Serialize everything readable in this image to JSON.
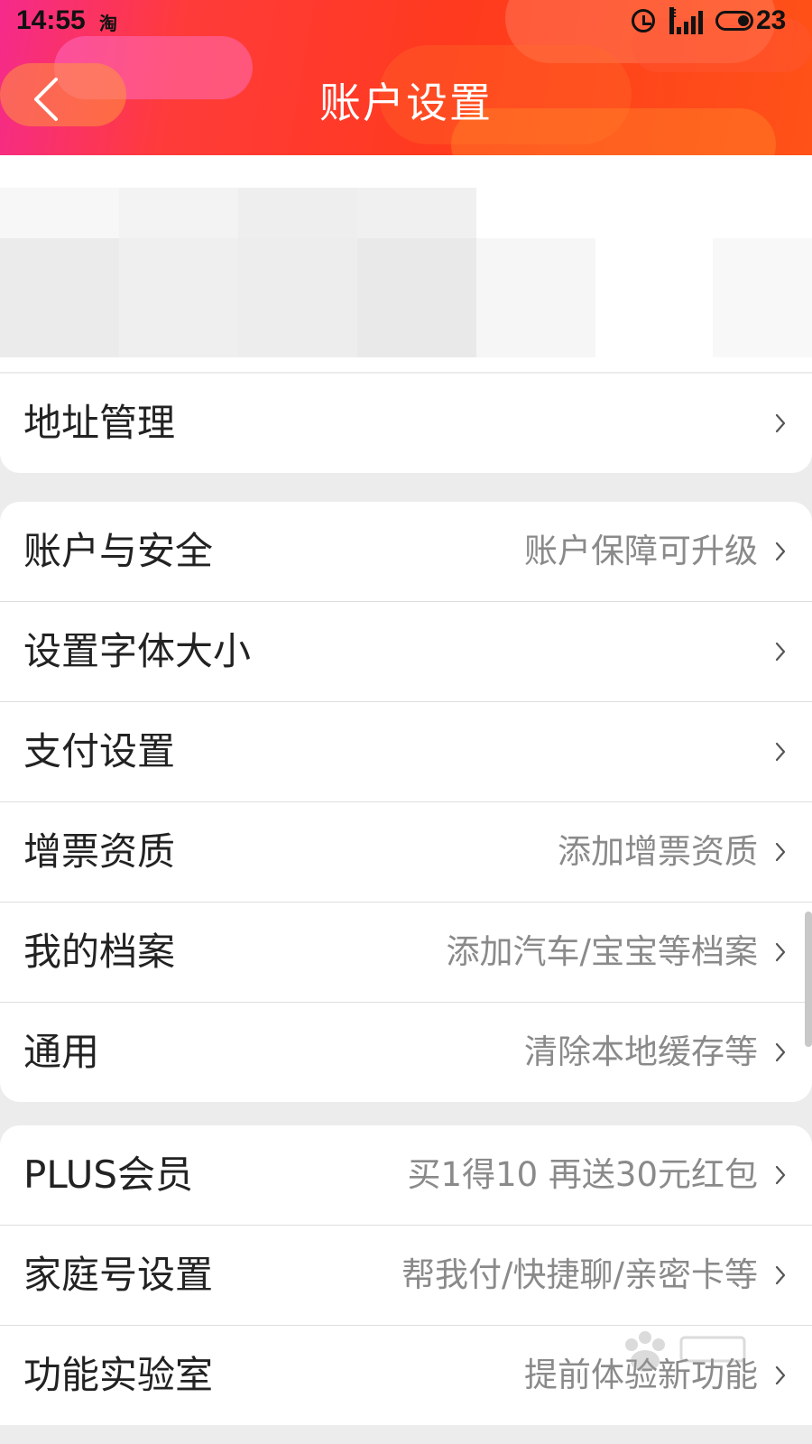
{
  "status_bar": {
    "time": "14:55",
    "app_icon": "淘",
    "battery": "23",
    "alarm_icon": "alarm-icon",
    "signal_icon": "signal-icon"
  },
  "header": {
    "title": "账户设置",
    "back_icon": "chevron-left-icon"
  },
  "profile": {
    "note": ""
  },
  "sections": [
    {
      "rows": [
        {
          "label": "地址管理",
          "value": ""
        }
      ]
    },
    {
      "rows": [
        {
          "label": "账户与安全",
          "value": "账户保障可升级"
        },
        {
          "label": "设置字体大小",
          "value": ""
        },
        {
          "label": "支付设置",
          "value": ""
        },
        {
          "label": "增票资质",
          "value": "添加增票资质"
        },
        {
          "label": "我的档案",
          "value": "添加汽车/宝宝等档案"
        },
        {
          "label": "通用",
          "value": "清除本地缓存等"
        }
      ]
    },
    {
      "rows": [
        {
          "label": "PLUS会员",
          "value": "买1得10 再送30元红包"
        },
        {
          "label": "家庭号设置",
          "value": "帮我付/快捷聊/亲密卡等"
        },
        {
          "label": "功能实验室",
          "value": "提前体验新功能"
        }
      ]
    }
  ],
  "colors": {
    "accent": "#ff3a1e",
    "label": "#222222",
    "value": "#8a8a8a"
  }
}
